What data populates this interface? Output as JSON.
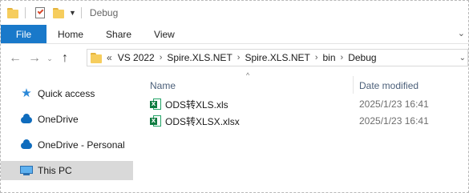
{
  "window": {
    "title": "Debug"
  },
  "quick_access": {
    "icons": [
      "folder-icon",
      "properties-icon",
      "new-folder-icon",
      "customize-quick-access-icon"
    ]
  },
  "ribbon": {
    "tabs": [
      "File",
      "Home",
      "Share",
      "View"
    ]
  },
  "navigation": {
    "back_icon": "back-arrow-icon",
    "forward_icon": "forward-arrow-icon",
    "recent_icon": "chevron-down-icon",
    "up_icon": "up-arrow-icon"
  },
  "address": {
    "overflow": "«",
    "breadcrumbs": [
      "VS 2022",
      "Spire.XLS.NET",
      "Spire.XLS.NET",
      "bin",
      "Debug"
    ]
  },
  "sidebar": {
    "items": [
      {
        "label": "Quick access",
        "icon": "star-icon"
      },
      {
        "label": "OneDrive",
        "icon": "cloud-icon"
      },
      {
        "label": "OneDrive - Personal",
        "icon": "cloud-icon"
      },
      {
        "label": "This PC",
        "icon": "computer-icon",
        "selected": true
      }
    ]
  },
  "content": {
    "columns": [
      "Name",
      "Date modified"
    ],
    "files": [
      {
        "name": "ODS转XLS.xls",
        "date": "2025/1/23 16:41",
        "icon": "excel-file-icon"
      },
      {
        "name": "ODS转XLSX.xlsx",
        "date": "2025/1/23 16:41",
        "icon": "excel-file-icon"
      }
    ]
  },
  "colors": {
    "accent": "#1979ca",
    "selected_row": "#d9d9d9",
    "header_text": "#4c607a",
    "excel_green": "#107c41"
  }
}
